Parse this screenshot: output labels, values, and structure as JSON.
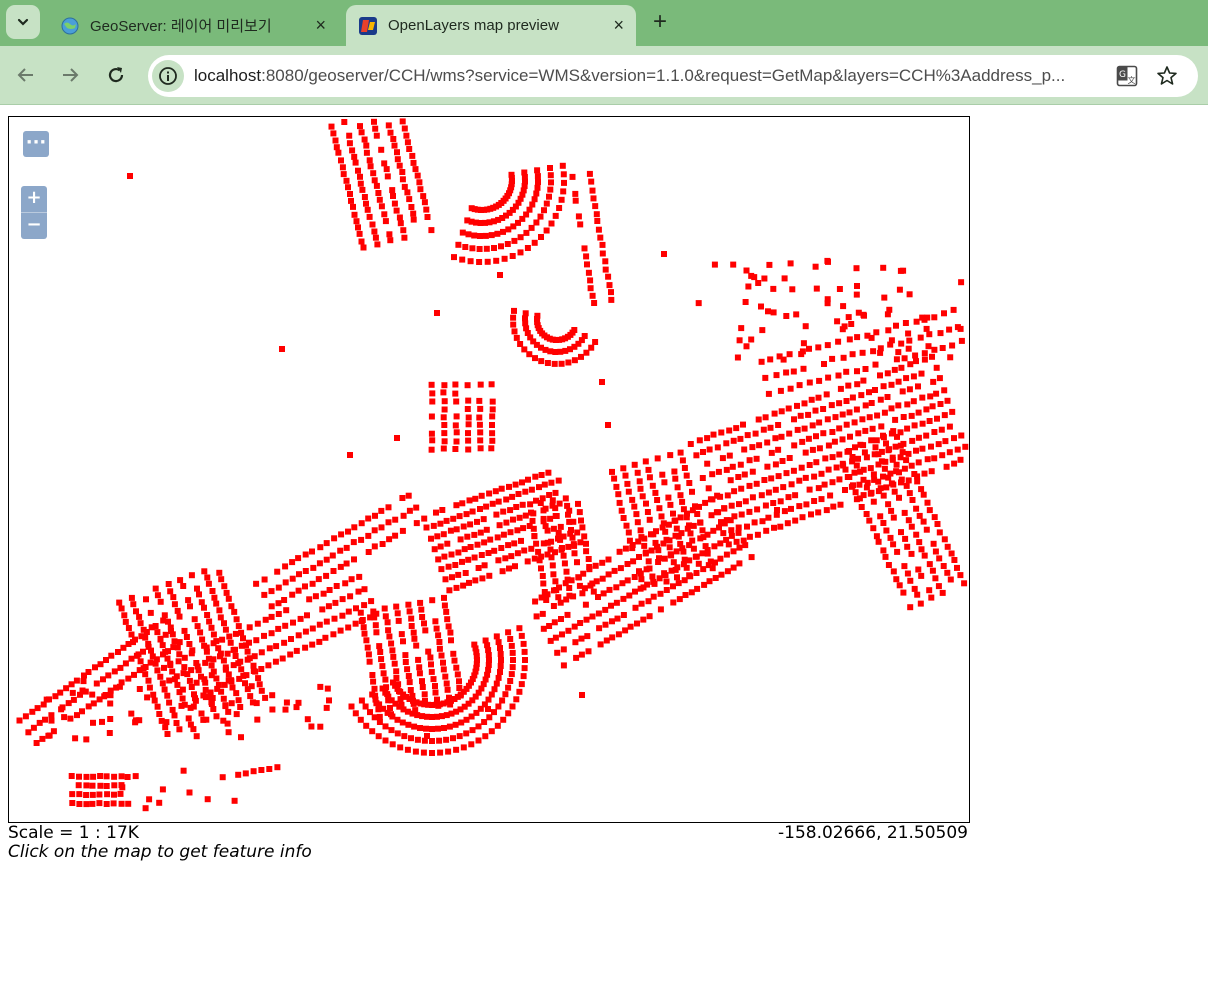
{
  "browser": {
    "tabs": [
      {
        "title": "GeoServer: 레이어 미리보기",
        "icon": "geoserver-globe-icon",
        "active": false
      },
      {
        "title": "OpenLayers map preview",
        "icon": "openlayers-icon",
        "active": true
      }
    ],
    "new_tab_label": "+",
    "close_label": "×",
    "address": {
      "host": "localhost",
      "rest": ":8080/geoserver/CCH/wms?service=WMS&version=1.1.0&request=GetMap&layers=CCH%3Aaddress_p..."
    }
  },
  "map": {
    "feature_color": "#ff0000",
    "controls": {
      "toggle_label": "···",
      "zoom_in_label": "+",
      "zoom_out_label": "−"
    },
    "scale_text": "Scale = 1 : 17K",
    "coordinates_text": "-158.02666, 21.50509",
    "hint_text": "Click on the map to get feature info"
  }
}
